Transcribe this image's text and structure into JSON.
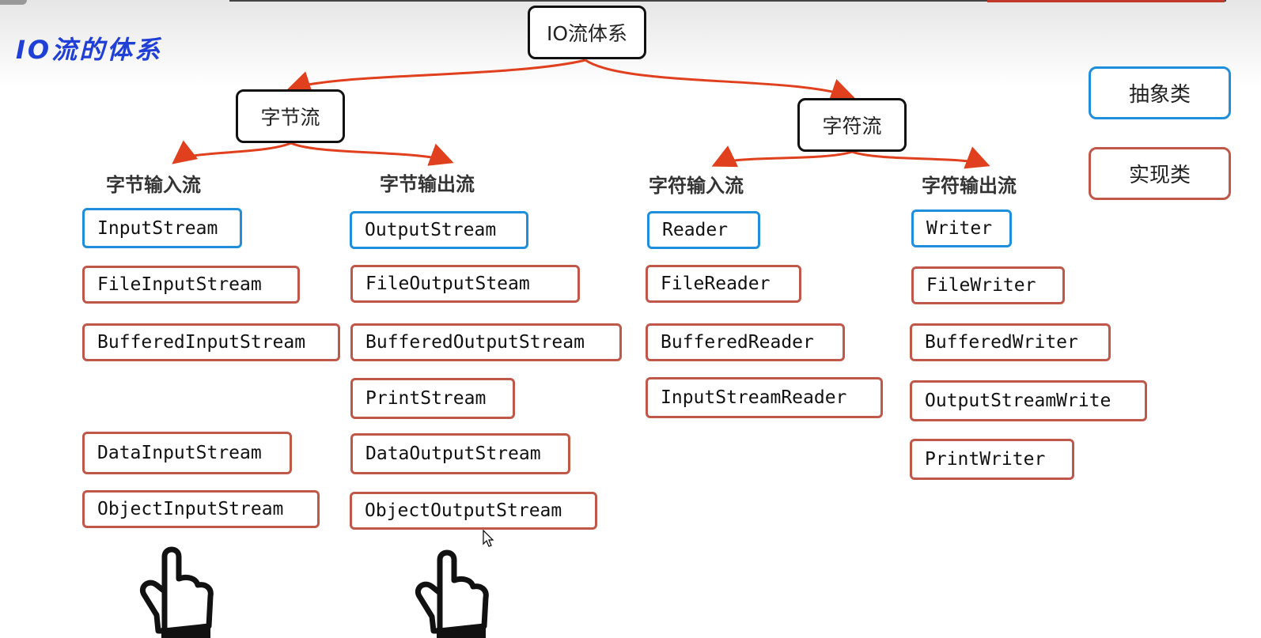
{
  "title_handwritten": "IO流的体系",
  "root": "IO流体系",
  "branches": {
    "byte": "字节流",
    "char": "字符流"
  },
  "columns": [
    {
      "header": "字节输入流",
      "abstract": "InputStream",
      "impl": [
        "FileInputStream",
        "BufferedInputStream",
        "DataInputStream",
        "ObjectInputStream"
      ]
    },
    {
      "header": "字节输出流",
      "abstract": "OutputStream",
      "impl": [
        "FileOutputSteam",
        "BufferedOutputStream",
        "PrintStream",
        "DataOutputStream",
        "ObjectOutputStream"
      ]
    },
    {
      "header": "字符输入流",
      "abstract": "Reader",
      "impl": [
        "FileReader",
        "BufferedReader",
        "InputStreamReader"
      ]
    },
    {
      "header": "字符输出流",
      "abstract": "Writer",
      "impl": [
        "FileWriter",
        "BufferedWriter",
        "OutputStreamWrite",
        "PrintWriter"
      ]
    }
  ],
  "legend": {
    "abstract": "抽象类",
    "impl": "实现类"
  },
  "colors": {
    "abstract_border": "#1f8fdc",
    "impl_border": "#c0584a",
    "arrow": "#e0401e",
    "title": "#1f3fd6"
  },
  "icons": [
    "pointing-hand-icon",
    "pointing-hand-icon",
    "mouse-cursor-icon"
  ]
}
